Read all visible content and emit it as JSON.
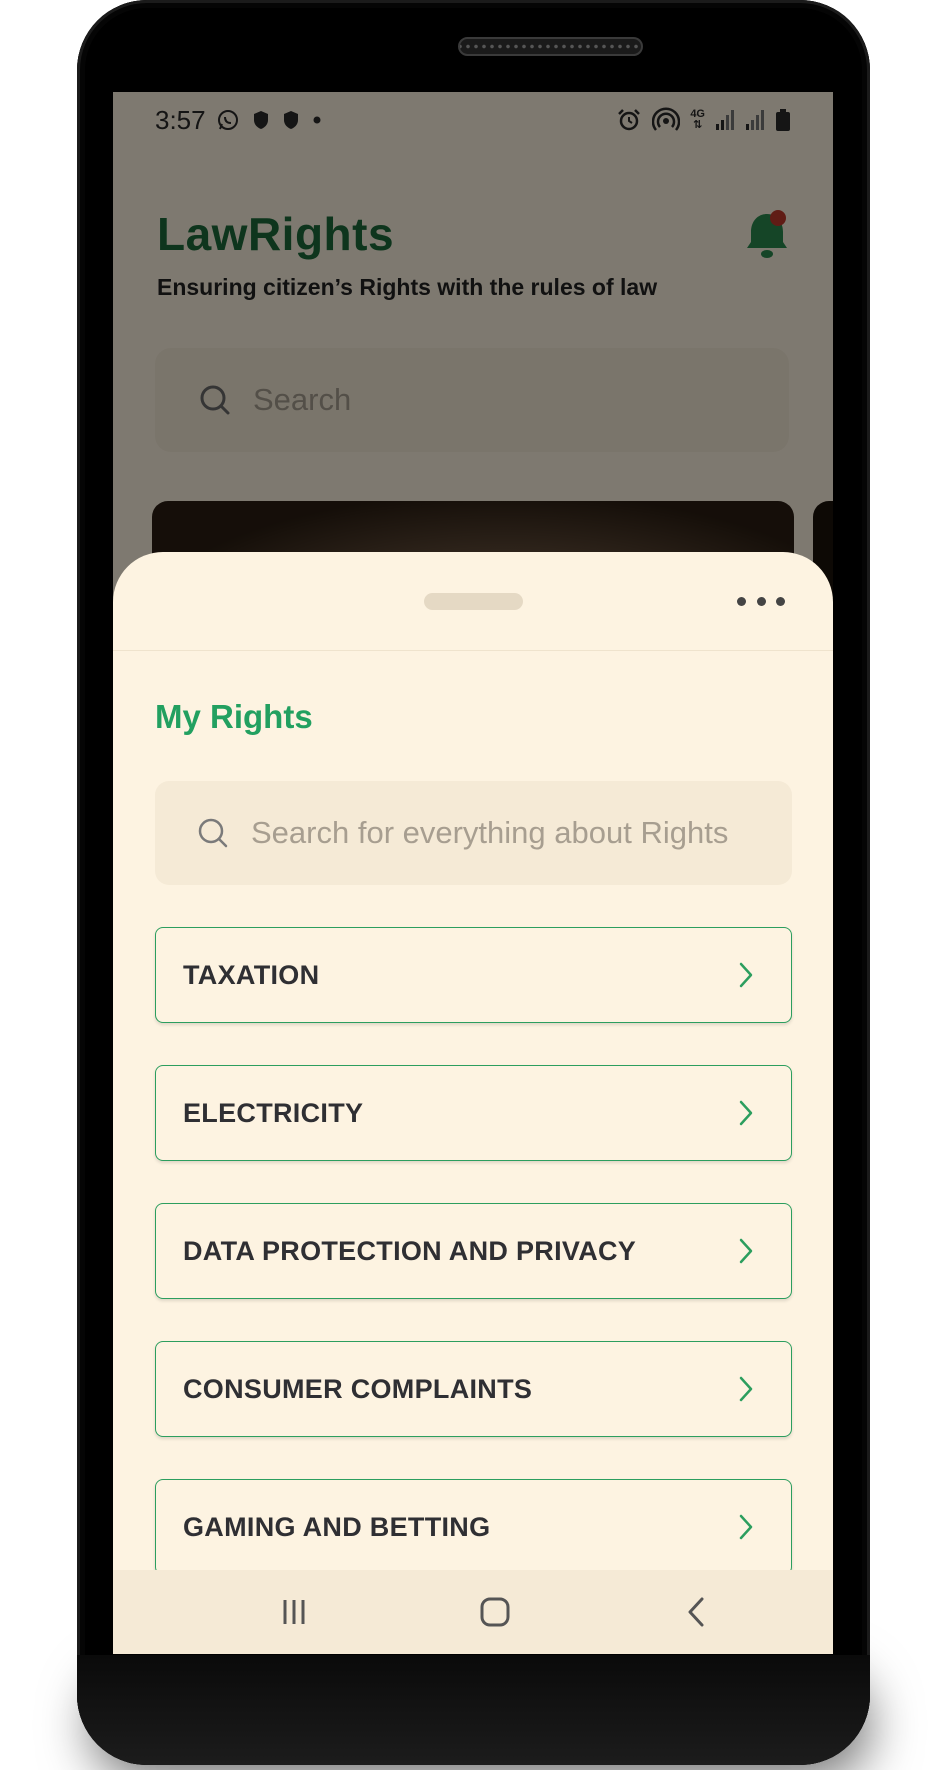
{
  "status_bar": {
    "time": "3:57",
    "left_icons": [
      "whatsapp-icon",
      "shield-icon",
      "shield-icon",
      "dot-icon"
    ],
    "right_icons": [
      "alarm-icon",
      "hotspot-icon",
      "network-4g-icon",
      "signal-icon",
      "signal-icon",
      "battery-icon"
    ],
    "network_label": "4G"
  },
  "app": {
    "title": "LawRights",
    "subtitle": "Ensuring citizen’s Rights with the rules of law",
    "search_placeholder": "Search",
    "notification_icon": "bell-icon"
  },
  "sheet": {
    "title": "My Rights",
    "search_placeholder": "Search for everything about Rights",
    "more_icon": "more-horizontal-icon",
    "items": [
      {
        "label": "TAXATION"
      },
      {
        "label": "ELECTRICITY"
      },
      {
        "label": "DATA PROTECTION AND PRIVACY"
      },
      {
        "label": "CONSUMER COMPLAINTS"
      },
      {
        "label": "GAMING AND BETTING"
      }
    ]
  },
  "nav_bar": {
    "buttons": [
      "recent-apps-icon",
      "home-icon",
      "back-icon"
    ]
  },
  "colors": {
    "accent_green": "#22a060",
    "title_green": "#1d6b3a",
    "sheet_background": "#fdf3e1",
    "notification_dot": "#c0392b"
  }
}
